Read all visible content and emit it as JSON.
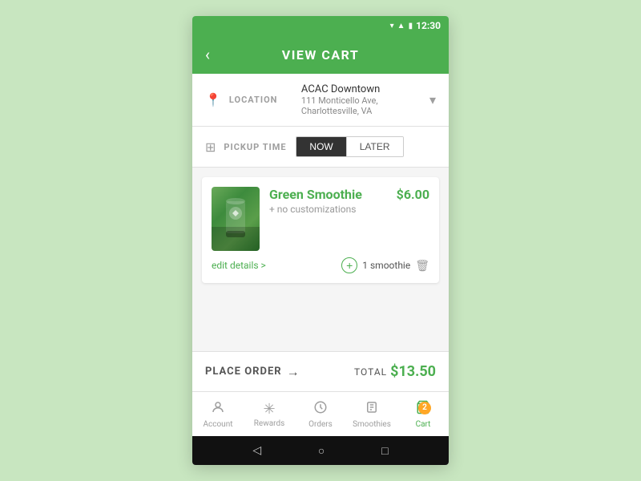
{
  "statusBar": {
    "time": "12:30"
  },
  "header": {
    "backIcon": "‹",
    "title": "VIEW CART"
  },
  "location": {
    "label": "LOCATION",
    "name": "ACAC Downtown",
    "address": "111 Monticello Ave, Charlottesville, VA"
  },
  "pickup": {
    "label": "PICKUP TIME",
    "nowLabel": "NOW",
    "laterLabel": "LATER"
  },
  "cartItem": {
    "name": "Green Smoothie",
    "customization": "+ no customizations",
    "price": "$6.00",
    "editLabel": "edit details >",
    "quantity": "1",
    "quantityUnit": "smoothie"
  },
  "placeOrder": {
    "label": "PLACE ORDER",
    "arrow": "→",
    "totalLabel": "TOTAL",
    "totalAmount": "$13.50"
  },
  "nav": {
    "items": [
      {
        "label": "Account",
        "icon": "👤"
      },
      {
        "label": "Rewards",
        "icon": "✳"
      },
      {
        "label": "Orders",
        "icon": "🔔"
      },
      {
        "label": "Smoothies",
        "icon": "▦"
      },
      {
        "label": "Cart",
        "icon": "🛒",
        "badge": "2"
      }
    ]
  },
  "androidNav": {
    "back": "◁",
    "home": "○",
    "recent": "□"
  }
}
